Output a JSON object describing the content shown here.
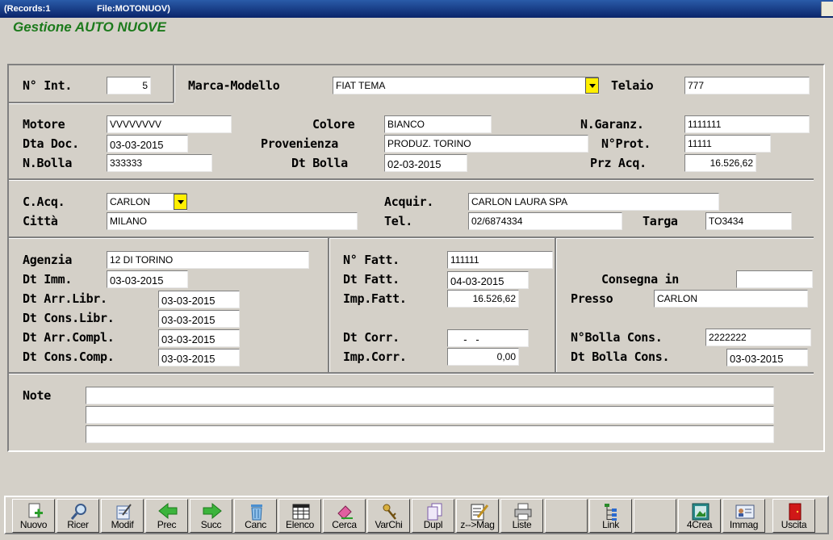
{
  "titlebar": {
    "records": "(Records:1",
    "file": "File:MOTONUOV)"
  },
  "app_title": "Gestione AUTO NUOVE",
  "labels": {
    "n_int": "N° Int.",
    "marca": "Marca-Modello",
    "telaio": "Telaio",
    "motore": "Motore",
    "colore": "Colore",
    "ngaranz": "N.Garanz.",
    "dtadoc": "Dta Doc.",
    "provenienza": "Provenienza",
    "nprot": "N°Prot.",
    "nbolla": "N.Bolla",
    "dtbolla": "Dt Bolla",
    "przacq": "Prz Acq.",
    "cacq": "C.Acq.",
    "acquir": "Acquir.",
    "citta": "Città",
    "tel": "Tel.",
    "targa": "Targa",
    "agenzia": "Agenzia",
    "dtimm": "Dt Imm.",
    "dtarrlibr": "Dt Arr.Libr.",
    "dtconslibr": "Dt Cons.Libr.",
    "dtarrcompl": "Dt Arr.Compl.",
    "dtconscomp": "Dt Cons.Comp.",
    "nfatt": "N° Fatt.",
    "dtfatt": "Dt Fatt.",
    "impfatt": "Imp.Fatt.",
    "dtcorr": "Dt Corr.",
    "impcorr": "Imp.Corr.",
    "consegna": "Consegna in",
    "presso": "Presso",
    "nbollacons": "N°Bolla Cons.",
    "dtbollacons": "Dt Bolla Cons.",
    "note": "Note"
  },
  "fields": {
    "n_int": "5",
    "marca": "FIAT TEMA",
    "telaio": "777",
    "motore": "VVVVVVVV",
    "colore": "BIANCO",
    "ngaranz": "1111111",
    "dtadoc": "03-03-2015",
    "provenienza": "PRODUZ. TORINO",
    "nprot": "11111",
    "nbolla": "333333",
    "dtbolla": "02-03-2015",
    "przacq": "16.526,62",
    "cacq": "CARLON",
    "acquir": "CARLON LAURA SPA",
    "citta": "MILANO",
    "tel": "02/6874334",
    "targa": "TO3434",
    "agenzia": "12 DI TORINO",
    "dtimm": "03-03-2015",
    "dtarrlibr": "03-03-2015",
    "dtconslibr": "03-03-2015",
    "dtarrcompl": "03-03-2015",
    "dtconscomp": "03-03-2015",
    "nfatt": "111111",
    "dtfatt": "04-03-2015",
    "impfatt": "16.526,62",
    "dtcorr": "  -   -",
    "impcorr": "0,00",
    "consegna": "",
    "presso": "CARLON",
    "nbollacons": "2222222",
    "dtbollacons": "03-03-2015",
    "note1": "",
    "note2": "",
    "note3": ""
  },
  "toolbar": [
    {
      "label": "Nuovo",
      "icon": "new-document-icon"
    },
    {
      "label": "Ricer",
      "icon": "magnifier-icon"
    },
    {
      "label": "Modif",
      "icon": "edit-document-icon"
    },
    {
      "label": "Prec",
      "icon": "arrow-left-icon"
    },
    {
      "label": "Succ",
      "icon": "arrow-right-icon"
    },
    {
      "label": "Canc",
      "icon": "trash-icon"
    },
    {
      "label": "Elenco",
      "icon": "grid-list-icon"
    },
    {
      "label": "Cerca",
      "icon": "eraser-search-icon"
    },
    {
      "label": "VarChi",
      "icon": "keys-icon"
    },
    {
      "label": "Dupl",
      "icon": "duplicate-icon"
    },
    {
      "label": "z-->Mag",
      "icon": "clipboard-pencil-icon"
    },
    {
      "label": "Liste",
      "icon": "printer-icon"
    },
    {
      "label": "",
      "icon": ""
    },
    {
      "label": "Link",
      "icon": "tree-icon"
    },
    {
      "label": "",
      "icon": ""
    },
    {
      "label": "4Crea",
      "icon": "frame-picture-icon"
    },
    {
      "label": "Immag",
      "icon": "id-card-icon"
    },
    {
      "label": "",
      "icon": ""
    },
    {
      "label": "Uscita",
      "icon": "exit-door-icon"
    }
  ]
}
